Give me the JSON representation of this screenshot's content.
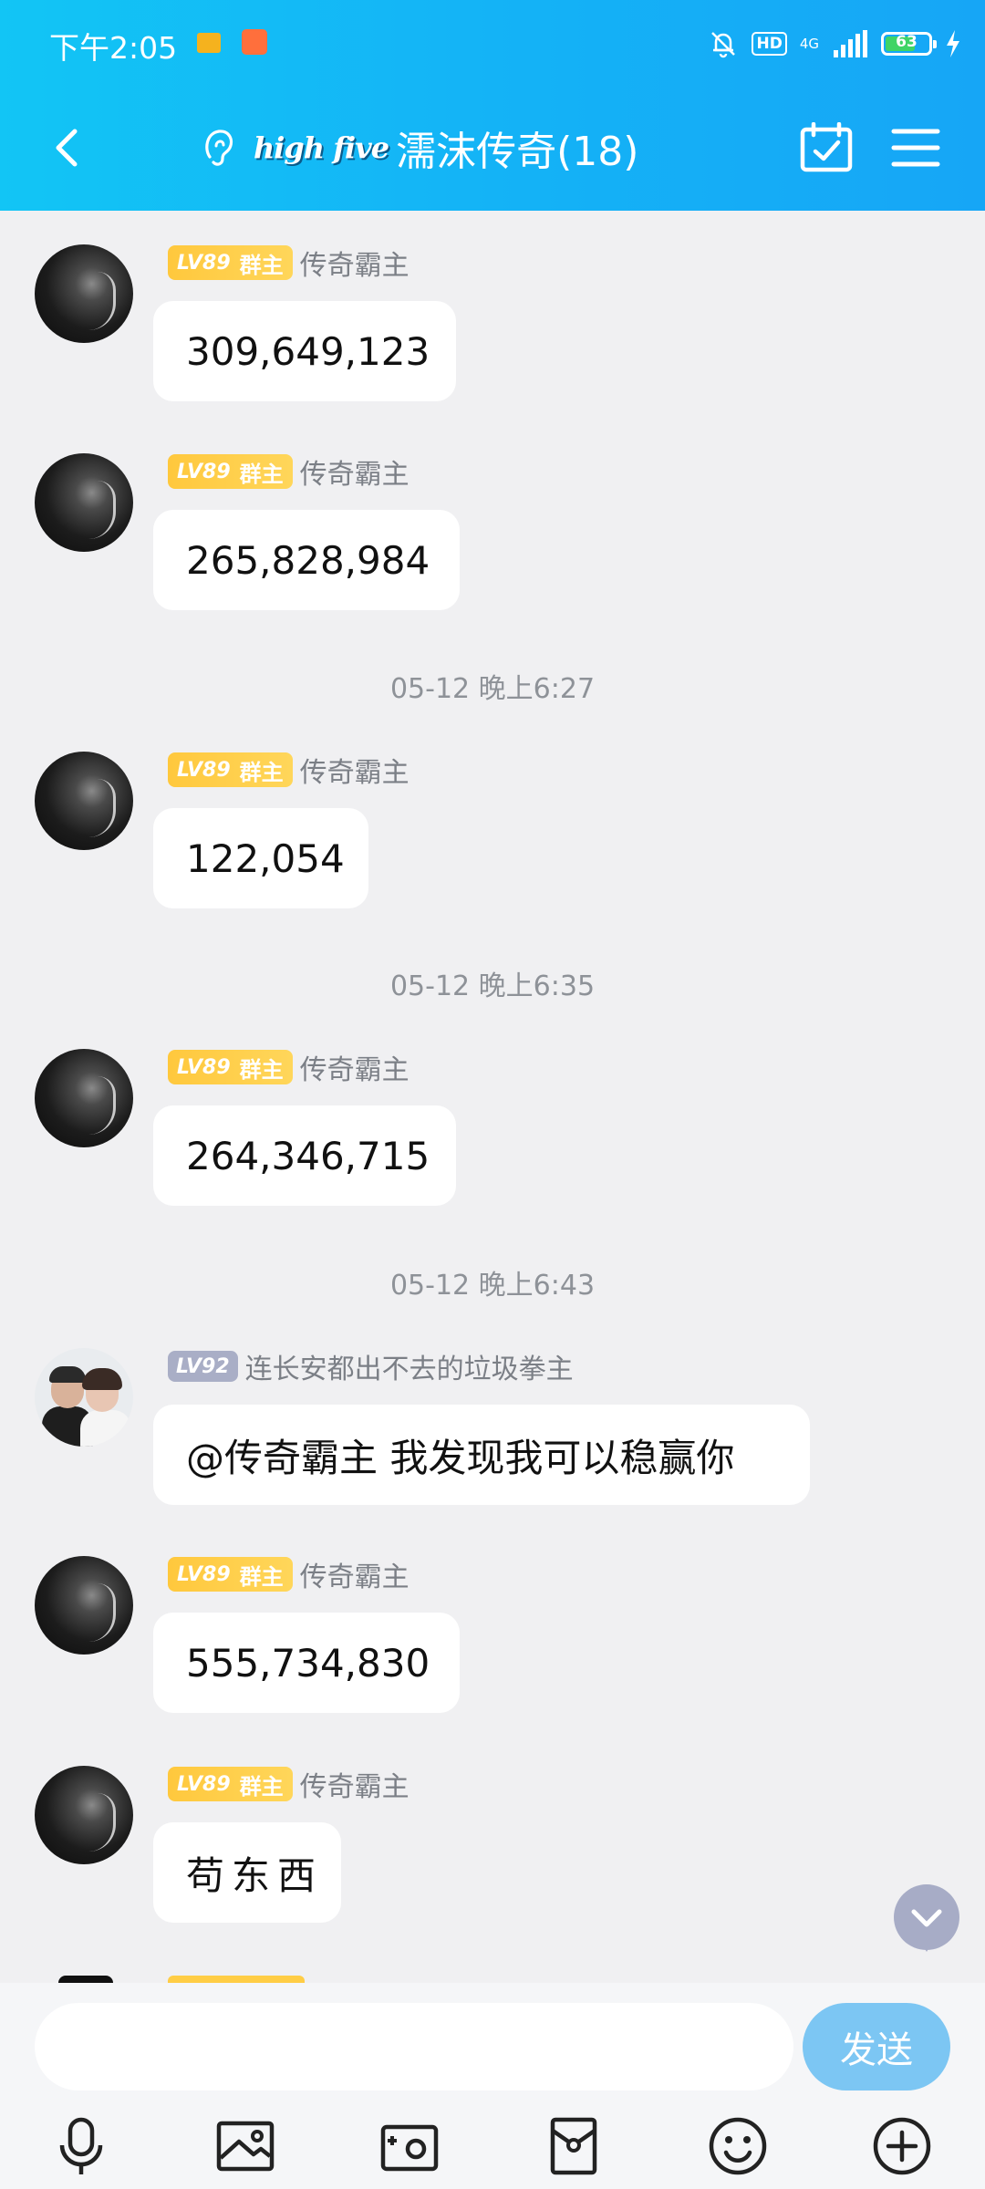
{
  "status_bar": {
    "time": "下午2:05",
    "hd": "HD",
    "network": "4G",
    "battery": "63"
  },
  "header": {
    "brand": "high five",
    "title": "濡沫传奇(18)"
  },
  "messages": [
    {
      "level": "LV89",
      "role": "群主",
      "sender": "传奇霸主",
      "text": "309,649,123",
      "avatar": "dark-profile-avatar"
    },
    {
      "level": "LV89",
      "role": "群主",
      "sender": "传奇霸主",
      "text": "265,828,984",
      "avatar": "dark-profile-avatar"
    },
    {
      "level": "LV89",
      "role": "群主",
      "sender": "传奇霸主",
      "text": "122,054",
      "avatar": "dark-profile-avatar"
    },
    {
      "level": "LV89",
      "role": "群主",
      "sender": "传奇霸主",
      "text": "264,346,715",
      "avatar": "dark-profile-avatar"
    },
    {
      "level": "LV92",
      "role": "",
      "sender": "连长安都出不去的垃圾拳主",
      "text": "@传奇霸主 我发现我可以稳赢你",
      "avatar": "couple-photo-avatar"
    },
    {
      "level": "LV89",
      "role": "群主",
      "sender": "传奇霸主",
      "text": "555,734,830",
      "avatar": "dark-profile-avatar"
    },
    {
      "level": "LV89",
      "role": "群主",
      "sender": "传奇霸主",
      "text": "苟东西",
      "avatar": "dark-profile-avatar"
    }
  ],
  "timestamps": [
    "05-12 晚上6:27",
    "05-12 晚上6:35",
    "05-12 晚上6:43"
  ],
  "input": {
    "value": "",
    "send_label": "发送"
  },
  "toolbar_icons": [
    "microphone-icon",
    "image-icon",
    "camera-icon",
    "red-packet-icon",
    "emoji-icon",
    "plus-icon"
  ],
  "colors": {
    "header_gradient_start": "#12c5f5",
    "header_gradient_end": "#16a6f6",
    "owner_badge": "#ffc83d",
    "level_badge": "#a9aec6",
    "send_button": "#7cc6f3",
    "background": "#f0f0f2"
  }
}
